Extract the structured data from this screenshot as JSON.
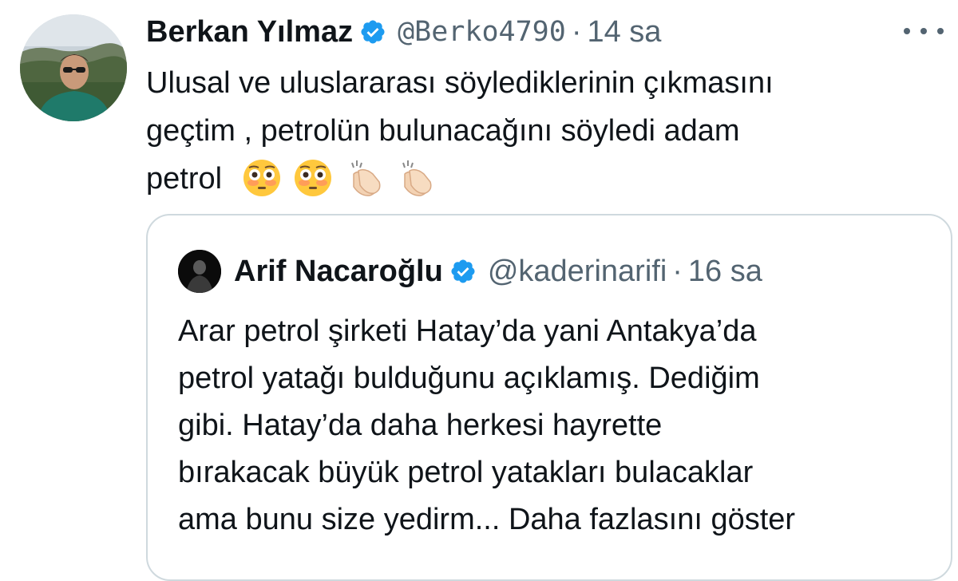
{
  "tweet": {
    "author_name": "Berkan Yılmaz",
    "author_handle": "@Berko4790",
    "separator": "·",
    "time": "14 sa",
    "text_line1": "Ulusal ve uluslararası söylediklerinin çıkmasını",
    "text_line2": "geçtim , petrolün bulunacağını söyledi adam",
    "text_line3": "petrol",
    "emojis": [
      "flushed-face-icon",
      "flushed-face-icon",
      "clapping-hands-icon",
      "clapping-hands-icon"
    ]
  },
  "quoted": {
    "author_name": "Arif Nacaroğlu",
    "author_handle": "@kaderinarifi",
    "separator": "·",
    "time": "16 sa",
    "lines": [
      "Arar petrol şirketi Hatay’da yani Antakya’da",
      "petrol yatağı bulduğunu açıklamış. Dediğim",
      "gibi. Hatay’da daha herkesi hayrette",
      "bırakacak büyük petrol yatakları bulacaklar",
      "ama bunu size yedirm..."
    ],
    "show_more": "Daha fazlasını göster"
  },
  "colors": {
    "text": "#0f1419",
    "secondary": "#536471",
    "verified": "#1d9bf0",
    "border": "#cfd9de"
  }
}
